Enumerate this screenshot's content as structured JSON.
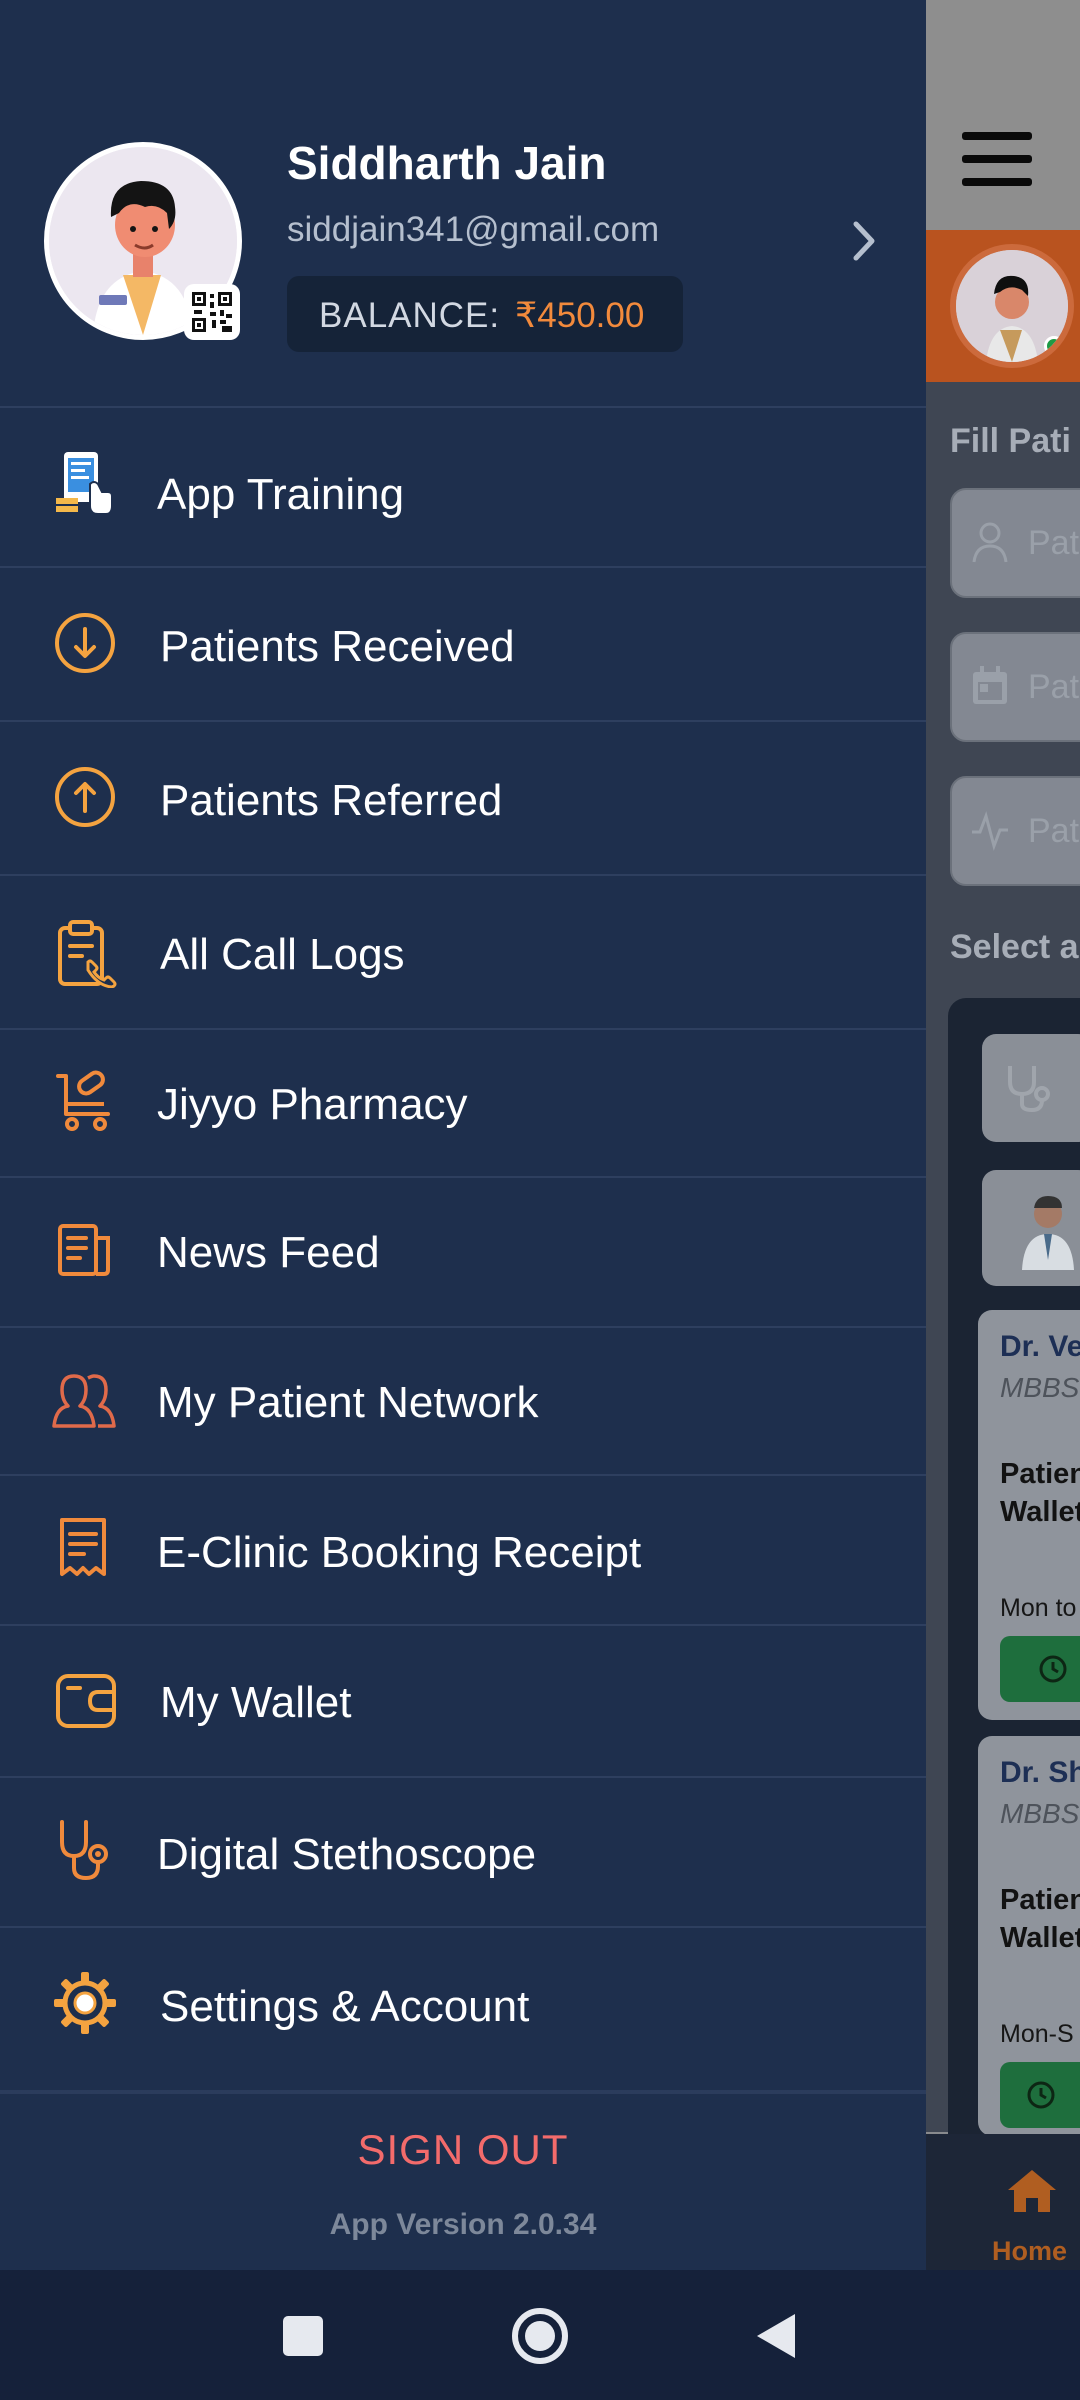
{
  "drawer": {
    "profile": {
      "name": "Siddharth Jain",
      "email": "siddjain341@gmail.com",
      "balance_label": "BALANCE:",
      "balance_amount": "₹450.00"
    },
    "menu": [
      {
        "label": "App Training",
        "icon": "app-training-icon"
      },
      {
        "label": "Patients Received",
        "icon": "arrow-down-circle-icon"
      },
      {
        "label": "Patients Referred",
        "icon": "arrow-up-circle-icon"
      },
      {
        "label": "All Call Logs",
        "icon": "clipboard-phone-icon"
      },
      {
        "label": "Jiyyo Pharmacy",
        "icon": "pharmacy-cart-icon"
      },
      {
        "label": "News Feed",
        "icon": "newspaper-icon"
      },
      {
        "label": "My Patient Network",
        "icon": "users-icon"
      },
      {
        "label": "E-Clinic Booking Receipt",
        "icon": "receipt-icon"
      },
      {
        "label": "My Wallet",
        "icon": "wallet-icon"
      },
      {
        "label": "Digital Stethoscope",
        "icon": "stethoscope-icon"
      },
      {
        "label": "Settings & Account",
        "icon": "gear-icon"
      }
    ],
    "sign_out": "SIGN OUT",
    "app_version": "App Version 2.0.34"
  },
  "background": {
    "fill_title": "Fill Pati",
    "fields": [
      "Pat",
      "Pat",
      "Pat"
    ],
    "select_title": "Select a",
    "cards": [
      {
        "name": "Dr. Ve",
        "degree": "MBBS",
        "line1": "Patien",
        "line2": "Wallet",
        "time": "Mon to"
      },
      {
        "name": "Dr. Sh",
        "degree": "MBBS",
        "line1": "Patien",
        "line2": "Wallet",
        "time": "Mon-S"
      }
    ],
    "bottom_nav_label": "Home"
  },
  "colors": {
    "drawer_bg": "#1e2f4d",
    "accent_orange": "#f28a3c",
    "sign_out_red": "#f36b6b",
    "divider": "#2e3f5f"
  }
}
